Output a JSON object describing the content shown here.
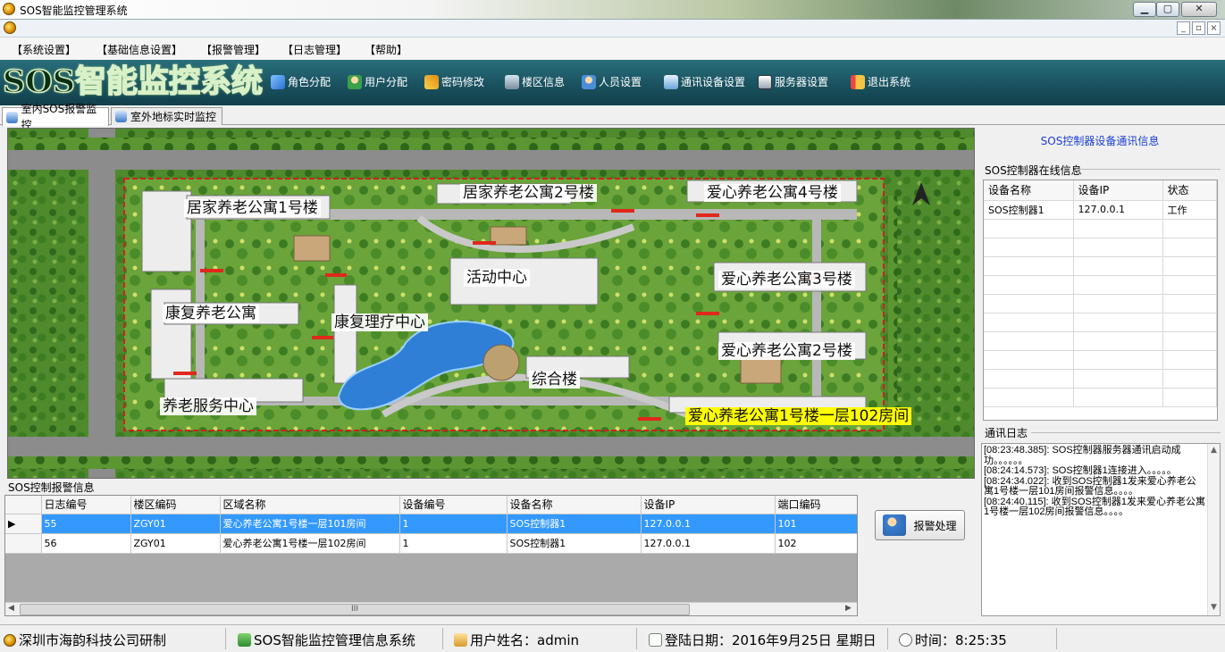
{
  "window": {
    "title": "SOS智能监控管理系统"
  },
  "menu": [
    "【系统设置】",
    "【基础信息设置】",
    "【报警管理】",
    "【日志管理】",
    "【帮助】"
  ],
  "toolbar": {
    "logo_text": "SOS智能监控系统",
    "buttons": [
      {
        "label": "角色分配",
        "icon": "role-icon"
      },
      {
        "label": "用户分配",
        "icon": "user-icon"
      },
      {
        "label": "密码修改",
        "icon": "password-icon"
      },
      {
        "label": "楼区信息",
        "icon": "building-icon"
      },
      {
        "label": "人员设置",
        "icon": "people-icon"
      },
      {
        "label": "通讯设备设置",
        "icon": "device-icon"
      },
      {
        "label": "服务器设置",
        "icon": "server-icon"
      },
      {
        "label": "退出系统",
        "icon": "exit-icon"
      }
    ]
  },
  "tabs": [
    {
      "label": "室内SOS报警监控",
      "active": true
    },
    {
      "label": "室外地标实时监控",
      "active": false
    }
  ],
  "map": {
    "labels": [
      {
        "text": "居家养老公寓1号楼",
        "highlight": false
      },
      {
        "text": "居家养老公寓2号楼",
        "highlight": false
      },
      {
        "text": "爱心养老公寓4号楼",
        "highlight": false
      },
      {
        "text": "活动中心",
        "highlight": false
      },
      {
        "text": "爱心养老公寓3号楼",
        "highlight": false
      },
      {
        "text": "康复养老公寓",
        "highlight": false
      },
      {
        "text": "康复理疗中心",
        "highlight": false
      },
      {
        "text": "爱心养老公寓2号楼",
        "highlight": false
      },
      {
        "text": "综合楼",
        "highlight": false
      },
      {
        "text": "养老服务中心",
        "highlight": false
      },
      {
        "text": "爱心养老公寓1号楼一层102房间",
        "highlight": true
      }
    ]
  },
  "right_panel": {
    "title": "SOS控制器设备通讯信息",
    "online_group": "SOS控制器在线信息",
    "device_columns": [
      "设备名称",
      "设备IP",
      "状态"
    ],
    "devices": [
      {
        "name": "SOS控制器1",
        "ip": "127.0.0.1",
        "status": "工作"
      }
    ],
    "log_group": "通讯日志",
    "log": "[08:23:48.385]: SOS控制器服务器通讯启动成功。。。。。。\n[08:24:14.573]: SOS控制器1连接进入。。。。。\n[08:24:34.022]: 收到SOS控制器1发来爱心养老公寓1号楼一层101房间报警信息。。。。\n[08:24:40.115]: 收到SOS控制器1发来爱心养老公寓1号楼一层102房间报警信息。。。。"
  },
  "alarm": {
    "group_label": "SOS控制报警信息",
    "columns": [
      "日志编号",
      "楼区编码",
      "区域名称",
      "设备编号",
      "设备名称",
      "设备IP",
      "端口编码"
    ],
    "rows": [
      {
        "selected": true,
        "cells": [
          "55",
          "ZGY01",
          "爱心养老公寓1号楼一层101房间",
          "1",
          "SOS控制器1",
          "127.0.0.1",
          "101"
        ]
      },
      {
        "selected": false,
        "cells": [
          "56",
          "ZGY01",
          "爱心养老公寓1号楼一层102房间",
          "1",
          "SOS控制器1",
          "127.0.0.1",
          "102"
        ]
      }
    ],
    "scroll_thumb_label": "III",
    "handle_button": "报警处理"
  },
  "status": {
    "company": "深圳市海韵科技公司研制",
    "system": "SOS智能监控管理信息系统",
    "user": "用户姓名：admin",
    "login_date": "登陆日期：2016年9月25日 星期日",
    "time": "时间：8:25:35"
  },
  "colors": {
    "toolbar_bg": "#1b5462",
    "selection": "#3399ff",
    "highlight_label": "#ffff00",
    "map_grass": "#4f8a2c",
    "map_road": "#8c8c8c"
  }
}
